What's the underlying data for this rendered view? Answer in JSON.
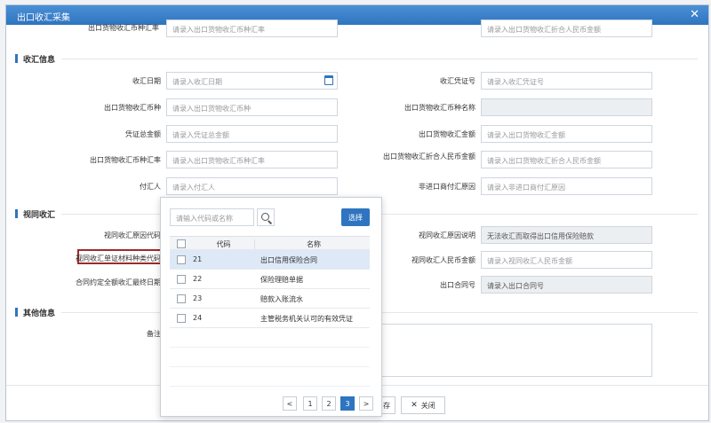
{
  "window": {
    "title": "出口收汇采集"
  },
  "top_row": {
    "left_label": "出口货物收汇币种汇率",
    "left_placeholder": "请录入出口货物收汇币种汇率",
    "right_placeholder": "请录入出口货物收汇折合人民币金额"
  },
  "sections": {
    "collection": "收汇信息",
    "deemed": "视同收汇",
    "other": "其他信息"
  },
  "collection": {
    "date_label": "收汇日期",
    "date_placeholder": "请录入收汇日期",
    "voucher_no_label": "收汇凭证号",
    "voucher_no_placeholder": "请录入收汇凭证号",
    "currency_label": "出口货物收汇币种",
    "currency_placeholder": "请录入出口货物收汇币种",
    "currency_name_label": "出口货物收汇币种名称",
    "voucher_amount_label": "凭证总金额",
    "voucher_amount_placeholder": "请录入凭证总金额",
    "export_amount_label": "出口货物收汇金额",
    "export_amount_placeholder": "请录入出口货物收汇金额",
    "rate_label": "出口货物收汇币种汇率",
    "rate_placeholder": "请录入出口货物收汇币种汇率",
    "rmb_label": "出口货物收汇折合人民币金额",
    "rmb_placeholder": "请录入出口货物收汇折合人民币金额",
    "remitter_label": "付汇人",
    "remitter_placeholder": "请录入付汇人",
    "non_origin_label": "非进口商付汇原因",
    "non_origin_placeholder": "请录入非进口商付汇原因"
  },
  "deemed": {
    "reason_code_label": "视同收汇原因代码",
    "doc_type_label": "视同收汇单证材料种类代码",
    "contract_date_label": "合同约定全额收汇最终日期",
    "reason_desc_label": "视同收汇原因说明",
    "reason_desc_value": "无法收汇而取得出口信用保险赔款",
    "rmb_amount_label": "视同收汇人民币金额",
    "rmb_amount_placeholder": "请录入视同收汇人民币金额",
    "contract_no_label": "出口合同号",
    "contract_no_placeholder": "请录入出口合同号"
  },
  "other": {
    "remark_label": "备注"
  },
  "footer": {
    "save_label": "存",
    "close_label": "关闭"
  },
  "popup": {
    "search_placeholder": "请输入代码或名称",
    "select_label": "选择",
    "col_code": "代码",
    "col_name": "名称",
    "rows": [
      {
        "code": "21",
        "name": "出口信用保险合同"
      },
      {
        "code": "22",
        "name": "保险理赔单据"
      },
      {
        "code": "23",
        "name": "赔款入账流水"
      },
      {
        "code": "24",
        "name": "主管税务机关认可的有效凭证"
      }
    ],
    "pages": [
      "1",
      "2",
      "3"
    ],
    "current_page": "3",
    "prev": "<",
    "next": ">"
  }
}
